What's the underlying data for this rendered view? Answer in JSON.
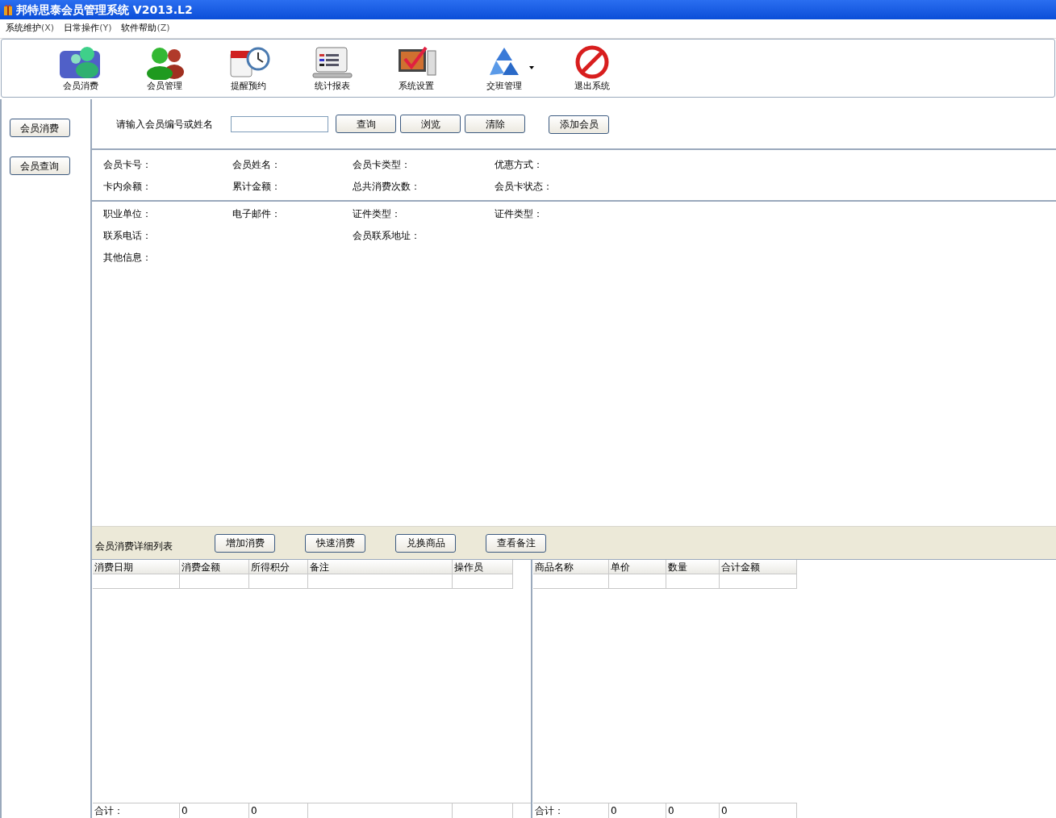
{
  "window": {
    "title": "邦特思泰会员管理系统 V2013.L2"
  },
  "menu": [
    {
      "label": "系统维护",
      "key": "(X)"
    },
    {
      "label": "日常操作",
      "key": "(Y)"
    },
    {
      "label": "软件帮助",
      "key": "(Z)"
    }
  ],
  "toolbar": [
    {
      "label": "会员消费",
      "dropdown": false
    },
    {
      "label": "会员管理",
      "dropdown": false
    },
    {
      "label": "提醒预约",
      "dropdown": false
    },
    {
      "label": "统计报表",
      "dropdown": false
    },
    {
      "label": "系统设置",
      "dropdown": false
    },
    {
      "label": "交班管理",
      "dropdown": true
    },
    {
      "label": "退出系统",
      "dropdown": false
    }
  ],
  "sidebar": {
    "buttons": [
      "会员消费",
      "会员查询"
    ]
  },
  "search": {
    "label": "请输入会员编号或姓名",
    "buttons": [
      "查询",
      "浏览",
      "清除"
    ],
    "add_button": "添加会员"
  },
  "card_info": [
    [
      "会员卡号：",
      "会员姓名：",
      "会员卡类型：",
      "优惠方式："
    ],
    [
      "卡内余额：",
      "累计金额：",
      "总共消费次数：",
      "会员卡状态："
    ]
  ],
  "personal_info": [
    [
      "职业单位：",
      "电子邮件：",
      "证件类型：",
      "证件类型："
    ],
    [
      "联系电话：",
      "会员联系地址："
    ],
    [
      "其他信息："
    ]
  ],
  "detail_bar": {
    "title": "会员消费详细列表",
    "buttons": [
      "增加消费",
      "快速消费",
      "兑换商品",
      "查看备注"
    ]
  },
  "consumption_table": {
    "columns": [
      "消费日期",
      "消费金额",
      "所得积分",
      "备注",
      "操作员"
    ],
    "totals": [
      "合计：",
      "0",
      "0"
    ]
  },
  "goods_table": {
    "columns": [
      "商品名称",
      "单价",
      "数量",
      "合计金额"
    ],
    "totals": [
      "合计：",
      "0",
      "0",
      "0"
    ]
  }
}
